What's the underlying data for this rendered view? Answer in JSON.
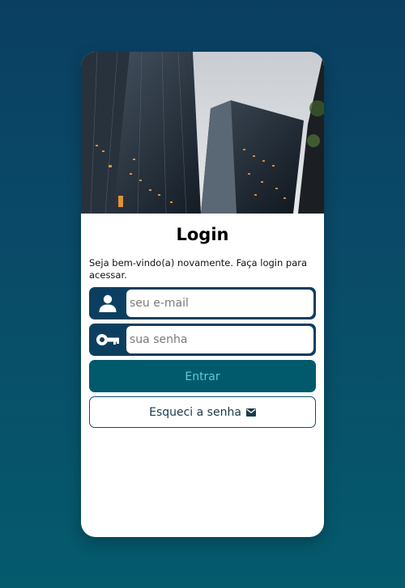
{
  "login": {
    "title": "Login",
    "subtitle": "Seja bem-vindo(a) novamente. Faça login para acessar.",
    "email": {
      "placeholder": "seu e-mail",
      "value": "",
      "icon": "user-icon"
    },
    "password": {
      "placeholder": "sua senha",
      "value": "",
      "icon": "key-icon"
    },
    "submit_label": "Entrar",
    "forgot_label": "Esqueci a senha",
    "forgot_icon": "envelope-icon"
  },
  "colors": {
    "background_top": "#0a3f62",
    "background_bottom": "#055a6c",
    "field_dark": "#0c3f5f",
    "button_primary": "#005a6c",
    "button_primary_text": "#5ec9dc",
    "card": "#ffffff"
  }
}
